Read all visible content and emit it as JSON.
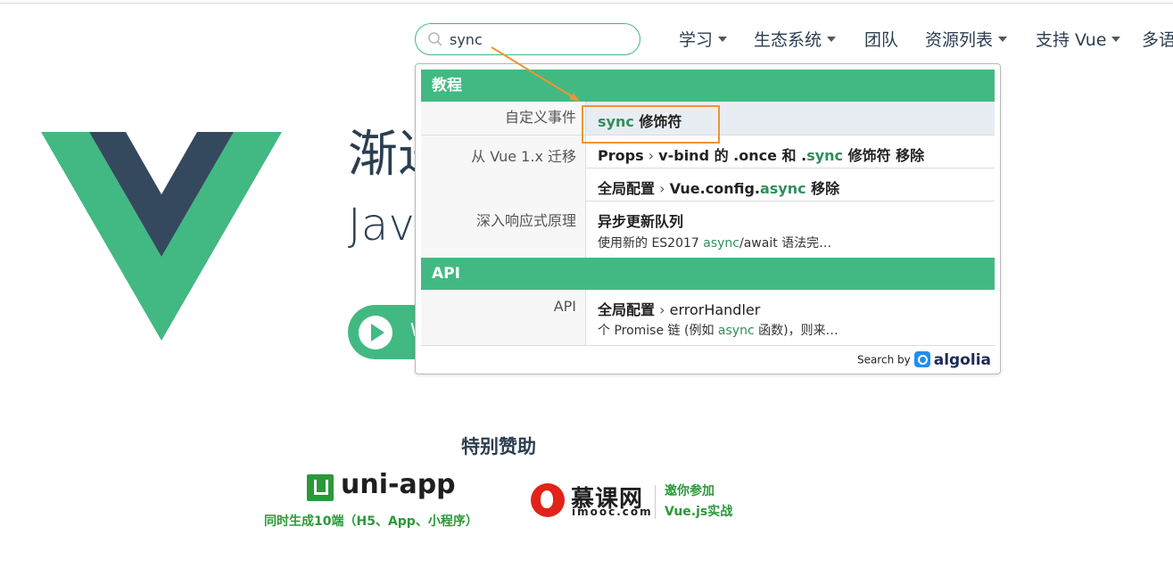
{
  "search": {
    "value": "sync"
  },
  "nav": [
    {
      "label": "学习",
      "dropdown": true
    },
    {
      "label": "生态系统",
      "dropdown": true
    },
    {
      "label": "团队",
      "dropdown": false
    },
    {
      "label": "资源列表",
      "dropdown": true
    },
    {
      "label": "支持 Vue",
      "dropdown": true
    },
    {
      "label": "多语",
      "dropdown": false
    }
  ],
  "hero": {
    "title": "渐进",
    "subtitle": "Jav",
    "start_button_initial": "W"
  },
  "results": {
    "categories": [
      {
        "name": "教程"
      },
      {
        "name": "API"
      }
    ],
    "rows": [
      {
        "subcategory": "自定义事件",
        "title_hl": "sync",
        "title_rest": " 修饰符"
      },
      {
        "subcategory": "从 Vue 1.x 迁移",
        "title_pre": "Props",
        "sep": " › ",
        "title_mid": "v-bind 的 .once 和 .",
        "title_hl": "sync",
        "title_rest": " 修饰符 移除"
      },
      {
        "title_pre": "全局配置",
        "sep": " › ",
        "title_mid": "Vue.config.",
        "title_hl": "async",
        "title_rest": " 移除"
      },
      {
        "subcategory": "深入响应式原理",
        "title": "异步更新队列",
        "snippet_pre": "使用新的 ES2017 ",
        "snippet_hl": "async",
        "snippet_rest": "/await 语法完…"
      },
      {
        "subcategory": "API",
        "title_pre": "全局配置",
        "sep": " › ",
        "title_mid": "errorHandler",
        "snippet_pre": "个 Promise 链 (例如 ",
        "snippet_hl": "async",
        "snippet_rest": " 函数)，则来…"
      }
    ],
    "footer_label": "Search by",
    "footer_brand": "algolia"
  },
  "sponsors": {
    "title": "特别赞助",
    "uni": {
      "name": "uni-app",
      "tagline": "同时生成10端（H5、App、小程序）"
    },
    "imooc": {
      "name": "慕课网",
      "domain": "imooc.com",
      "tag1": "邀你参加",
      "tag2": "Vue.js实战"
    }
  },
  "colors": {
    "accent": "#42b983",
    "text": "#2c3e50",
    "annotation": "#ef9435"
  }
}
